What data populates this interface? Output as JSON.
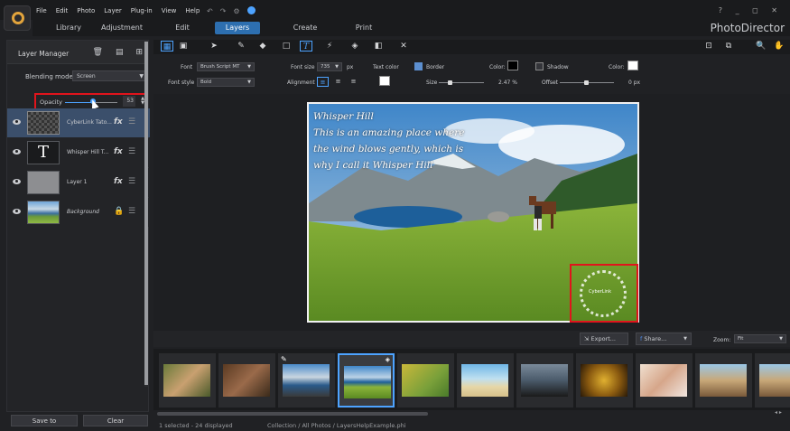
{
  "app": {
    "brand": "PhotoDirector",
    "window_controls": "? _ ◻ ✕"
  },
  "menu": [
    "File",
    "Edit",
    "Photo",
    "Layer",
    "Plug-in",
    "View",
    "Help"
  ],
  "nav_tabs": [
    "Library",
    "Adjustment",
    "Edit",
    "Layers",
    "Create",
    "Print"
  ],
  "active_tab": "Layers",
  "layer_manager": {
    "title": "Layer Manager",
    "blending_label": "Blending mode:",
    "blending_value": "Screen",
    "opacity_label": "Opacity",
    "opacity_value": "53",
    "opacity_fraction": 0.53,
    "layers": [
      {
        "name": "CyberLink Tato...",
        "kind": "checker",
        "selected": true
      },
      {
        "name": "Whisper Hill T...",
        "kind": "text",
        "selected": false
      },
      {
        "name": "Layer 1",
        "kind": "gray",
        "selected": false
      },
      {
        "name": "Background",
        "kind": "photo",
        "selected": false
      }
    ],
    "text_thumb_glyph": "T",
    "fx_label": "fx",
    "save_button": "Save to",
    "clear_button": "Clear"
  },
  "text_options": {
    "font_label": "Font",
    "font_value": "Brush Script MT",
    "style_label": "Font style",
    "style_value": "Bold",
    "size_label": "Font size",
    "size_value": "735",
    "size_unit": "px",
    "alignment_label": "Alignment",
    "text_color_label": "Text color",
    "border_label": "Border",
    "border_color_label": "Color:",
    "border_size_label": "Size",
    "border_size_value": "2.47 %",
    "shadow_label": "Shadow",
    "shadow_color_label": "Color:",
    "offset_label": "Offset",
    "offset_value": "0 px"
  },
  "canvas": {
    "text_lines": [
      "Whisper Hill",
      " This is an amazing place where",
      "the wind blows gently, which is",
      "why I call it Whisper Hill"
    ],
    "stamp_text": "CyberLink"
  },
  "browser": {
    "export_label": "Export...",
    "share_label": "Share...",
    "zoom_label": "Zoom:",
    "zoom_value": "Fit",
    "status_selected": "1 selected - 24 displayed",
    "status_path": "Collection / All Photos / LayersHelpExample.phi"
  }
}
